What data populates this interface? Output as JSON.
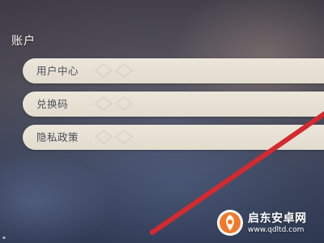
{
  "account_section": {
    "title": "账户",
    "items": [
      {
        "label": "用户中心"
      },
      {
        "label": "兑换码"
      },
      {
        "label": "隐私政策"
      }
    ]
  },
  "watermark": {
    "brand": "启东安卓网",
    "url": "www.qdltd.com"
  },
  "colors": {
    "item_background": "#e7e1d5",
    "item_text": "#4a4e5a",
    "annotation_line": "#d42a2f",
    "logo_orange": "#f07a2a"
  }
}
